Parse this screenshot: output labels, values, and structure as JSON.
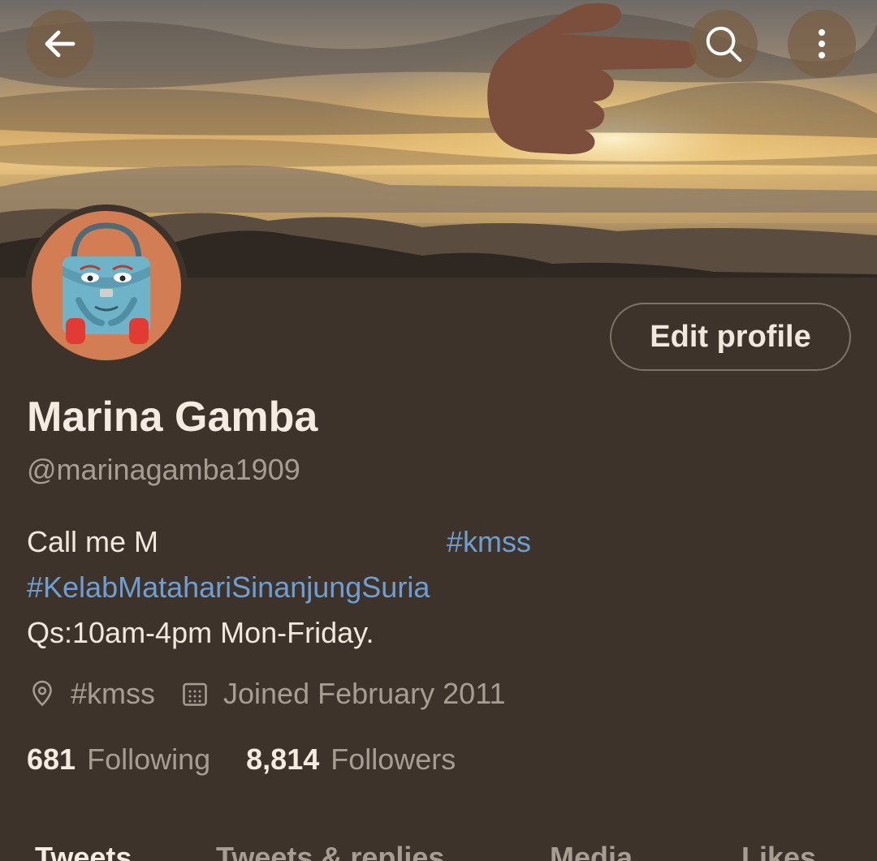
{
  "header": {
    "back_icon": "arrow-left-icon",
    "search_icon": "search-icon",
    "more_icon": "more-vertical-icon"
  },
  "profile": {
    "display_name": "Marina Gamba",
    "handle": "@marinagamba1909",
    "edit_button_label": "Edit profile",
    "bio": {
      "line1_text": "Call me M",
      "line1_hashtag": "#kmss",
      "line2_hashtag": "#KelabMatahariSinanjungSuria",
      "line3_text": "Qs:10am-4pm Mon-Friday."
    },
    "location": "#kmss",
    "joined": "Joined February 2011",
    "following_count": "681",
    "following_label": "Following",
    "followers_count": "8,814",
    "followers_label": "Followers"
  },
  "tabs": [
    {
      "label": "Tweets",
      "active": true
    },
    {
      "label": "Tweets & replies",
      "active": false
    },
    {
      "label": "Media",
      "active": false
    },
    {
      "label": "Likes",
      "active": false
    }
  ],
  "colors": {
    "background": "#3d332b",
    "hashtag": "#6e9fd3",
    "primary_text": "#f6ebe0",
    "secondary_text": "#a89d92"
  }
}
